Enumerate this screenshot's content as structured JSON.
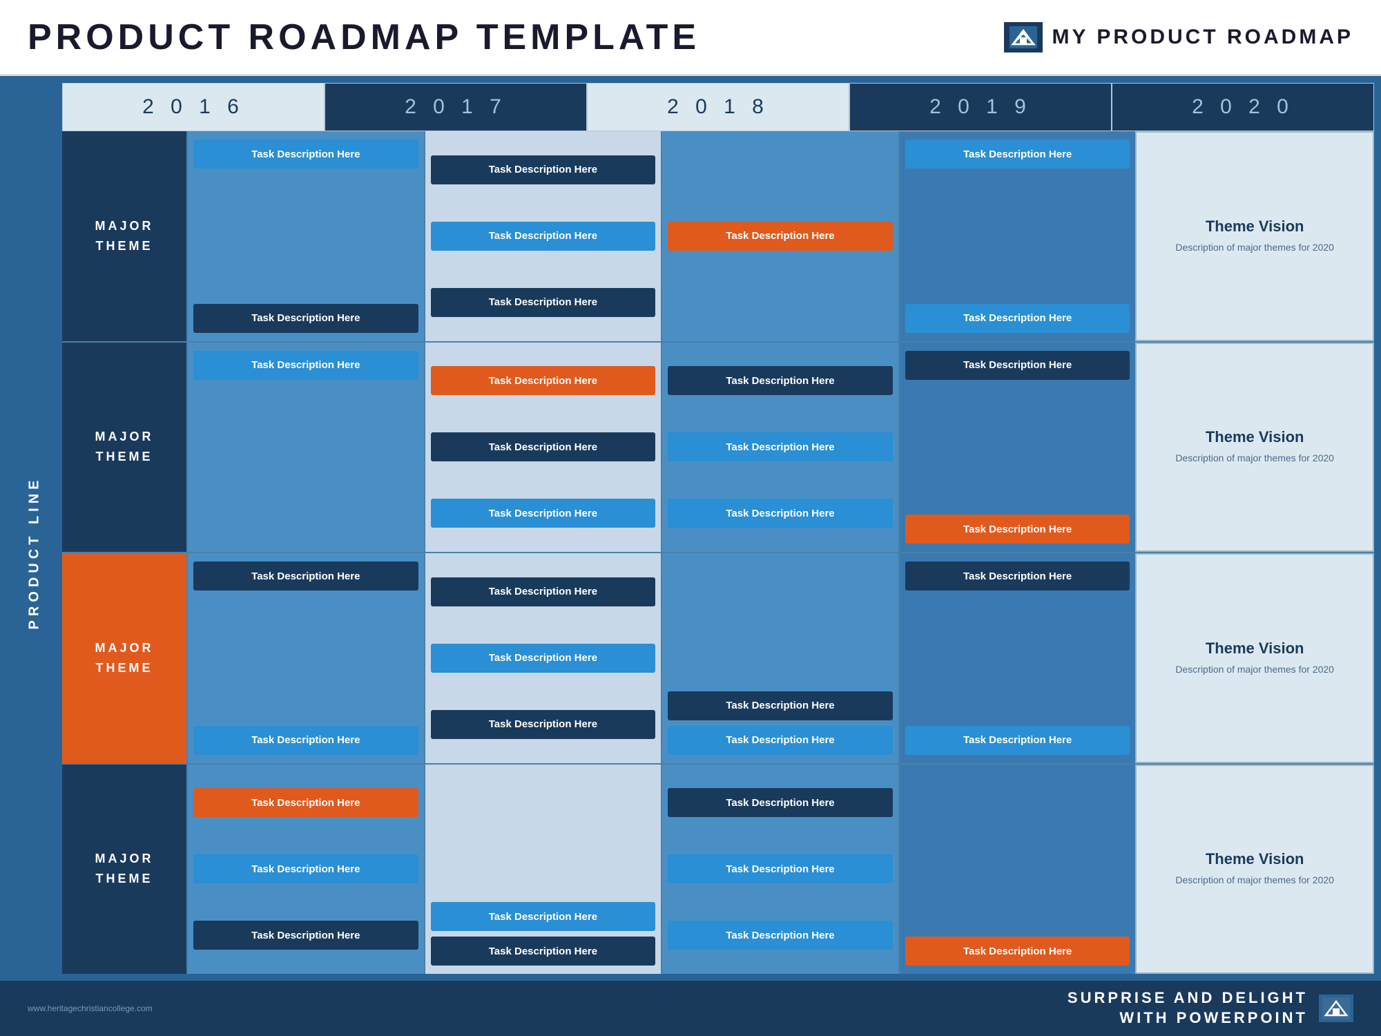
{
  "header": {
    "title": "PRODUCT ROADMAP TEMPLATE",
    "subtitle": "MY PRODUCT ROADMAP"
  },
  "years": [
    "2 0 1 6",
    "2 0 1 7",
    "2 0 1 8",
    "2 0 1 9",
    "2 0 2 0"
  ],
  "sidebar_label": "PRODUCT LINE",
  "rows": [
    {
      "label": "MAJOR\nTHEME",
      "label_style": "blue",
      "cells": [
        {
          "tasks": [
            {
              "text": "Task Description Here",
              "style": "cyan",
              "pos": "top"
            },
            {
              "text": "Task Description Here",
              "style": "blue-dark",
              "pos": "bottom"
            }
          ]
        },
        {
          "tasks": [
            {
              "text": "Task Description Here",
              "style": "blue-dark",
              "pos": "top"
            },
            {
              "text": "Task Description Here",
              "style": "cyan",
              "pos": "mid"
            },
            {
              "text": "Task Description Here",
              "style": "blue-dark",
              "pos": "bottom"
            }
          ]
        },
        {
          "tasks": [
            {
              "text": "Task Description Here",
              "style": "orange",
              "pos": "mid"
            }
          ]
        },
        {
          "tasks": [
            {
              "text": "Task Description Here",
              "style": "cyan",
              "pos": "top"
            },
            {
              "text": "Task Description Here",
              "style": "cyan",
              "pos": "bottom"
            }
          ]
        },
        {
          "vision": true,
          "title": "Theme Vision",
          "desc": "Description of major themes for 2020"
        }
      ]
    },
    {
      "label": "MAJOR\nTHEME",
      "label_style": "blue",
      "cells": [
        {
          "tasks": [
            {
              "text": "Task Description Here",
              "style": "cyan",
              "pos": "top"
            }
          ]
        },
        {
          "tasks": [
            {
              "text": "Task Description Here",
              "style": "orange",
              "pos": "top"
            },
            {
              "text": "Task Description Here",
              "style": "blue-dark",
              "pos": "mid"
            },
            {
              "text": "Task Description Here",
              "style": "cyan",
              "pos": "bottom"
            }
          ]
        },
        {
          "tasks": [
            {
              "text": "Task Description Here",
              "style": "blue-dark",
              "pos": "mid"
            },
            {
              "text": "Task Description Here",
              "style": "cyan",
              "pos": "mid2"
            },
            {
              "text": "Task Description Here",
              "style": "cyan",
              "pos": "bottom"
            }
          ]
        },
        {
          "tasks": [
            {
              "text": "Task Description Here",
              "style": "blue-dark",
              "pos": "top"
            },
            {
              "text": "Task Description Here",
              "style": "orange",
              "pos": "bottom"
            }
          ]
        },
        {
          "vision": true,
          "title": "Theme Vision",
          "desc": "Description of major themes for 2020"
        }
      ]
    },
    {
      "label": "MAJOR\nTHEME",
      "label_style": "orange",
      "cells": [
        {
          "tasks": [
            {
              "text": "Task Description Here",
              "style": "blue-dark",
              "pos": "top"
            },
            {
              "text": "Task Description Here",
              "style": "cyan",
              "pos": "bottom"
            }
          ]
        },
        {
          "tasks": [
            {
              "text": "Task Description Here",
              "style": "blue-dark",
              "pos": "top"
            },
            {
              "text": "Task Description Here",
              "style": "cyan",
              "pos": "mid"
            },
            {
              "text": "Task Description Here",
              "style": "blue-dark",
              "pos": "bottom"
            }
          ]
        },
        {
          "tasks": [
            {
              "text": "Task Description Here",
              "style": "blue-dark",
              "pos": "mid"
            },
            {
              "text": "Task Description Here",
              "style": "cyan",
              "pos": "bottom"
            }
          ]
        },
        {
          "tasks": [
            {
              "text": "Task Description Here",
              "style": "blue-dark",
              "pos": "top"
            },
            {
              "text": "Task Description Here",
              "style": "cyan",
              "pos": "bottom"
            }
          ]
        },
        {
          "vision": true,
          "title": "Theme Vision",
          "desc": "Description of major themes for 2020"
        }
      ]
    },
    {
      "label": "MAJOR\nTHEME",
      "label_style": "blue",
      "cells": [
        {
          "tasks": [
            {
              "text": "Task Description Here",
              "style": "orange",
              "pos": "top"
            },
            {
              "text": "Task Description Here",
              "style": "cyan",
              "pos": "mid"
            },
            {
              "text": "Task Description Here",
              "style": "blue-dark",
              "pos": "bottom"
            }
          ]
        },
        {
          "tasks": [
            {
              "text": "Task Description Here",
              "style": "cyan",
              "pos": "top"
            },
            {
              "text": "Task Description Here",
              "style": "blue-dark",
              "pos": "bottom"
            }
          ]
        },
        {
          "tasks": [
            {
              "text": "Task Description Here",
              "style": "blue-dark",
              "pos": "top"
            },
            {
              "text": "Task Description Here",
              "style": "cyan",
              "pos": "mid"
            },
            {
              "text": "Task Description Here",
              "style": "cyan",
              "pos": "bottom"
            }
          ]
        },
        {
          "tasks": [
            {
              "text": "Task Description Here",
              "style": "orange",
              "pos": "bottom"
            }
          ]
        },
        {
          "vision": true,
          "title": "Theme Vision",
          "desc": "Description of major themes for 2020"
        }
      ]
    }
  ],
  "footer": {
    "website": "www.heritagechristiancollege.com",
    "tagline_line1": "SURPRISE AND DELIGHT",
    "tagline_line2": "WITH POWERPOINT"
  }
}
